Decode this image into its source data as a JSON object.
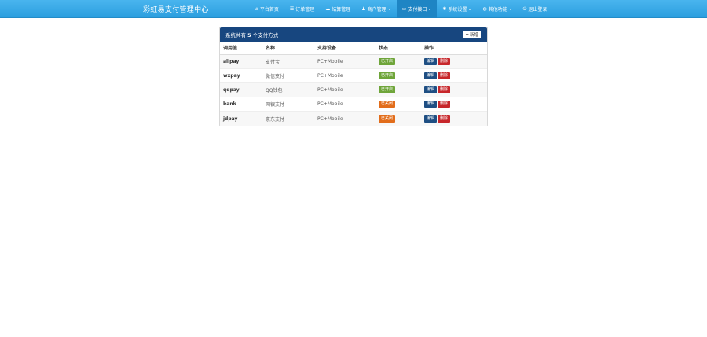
{
  "brand": "彩虹易支付管理中心",
  "nav": [
    {
      "icon": "home-icon",
      "glyph": "⌂",
      "label": "平台首页",
      "dropdown": false,
      "active": false
    },
    {
      "icon": "list-icon",
      "glyph": "☰",
      "label": "订单管理",
      "dropdown": false,
      "active": false
    },
    {
      "icon": "cloud-icon",
      "glyph": "☁",
      "label": "结算管理",
      "dropdown": false,
      "active": false
    },
    {
      "icon": "user-icon",
      "glyph": "♟",
      "label": "商户管理",
      "dropdown": true,
      "active": false
    },
    {
      "icon": "credit-card-icon",
      "glyph": "▭",
      "label": "支付接口",
      "dropdown": true,
      "active": true
    },
    {
      "icon": "settings-icon",
      "glyph": "✱",
      "label": "系统设置",
      "dropdown": true,
      "active": false
    },
    {
      "icon": "globe-icon",
      "glyph": "◍",
      "label": "其他功能",
      "dropdown": true,
      "active": false
    },
    {
      "icon": "power-icon",
      "glyph": "⏻",
      "label": "退出登录",
      "dropdown": false,
      "active": false
    }
  ],
  "panel": {
    "title_prefix": "系统共有 ",
    "count": "5",
    "title_suffix": " 个支付方式",
    "add_label": "新增"
  },
  "table": {
    "headers": [
      "调用值",
      "名称",
      "支持设备",
      "状态",
      "操作"
    ],
    "rows": [
      {
        "code": "alipay",
        "name": "支付宝",
        "device": "PC+Mobile",
        "status": "已开启",
        "on": true
      },
      {
        "code": "wxpay",
        "name": "微信支付",
        "device": "PC+Mobile",
        "status": "已开启",
        "on": true
      },
      {
        "code": "qqpay",
        "name": "QQ钱包",
        "device": "PC+Mobile",
        "status": "已开启",
        "on": true
      },
      {
        "code": "bank",
        "name": "网银支付",
        "device": "PC+Mobile",
        "status": "已关闭",
        "on": false
      },
      {
        "code": "jdpay",
        "name": "京东支付",
        "device": "PC+Mobile",
        "status": "已关闭",
        "on": false
      }
    ],
    "edit_label": "编辑",
    "delete_label": "删除"
  },
  "colors": {
    "navbar": "#2c9fdf",
    "panel_header": "#17467f",
    "status_on": "#6fa53a",
    "status_off": "#e26d1b",
    "edit": "#1f4f83",
    "delete": "#c7272b"
  }
}
